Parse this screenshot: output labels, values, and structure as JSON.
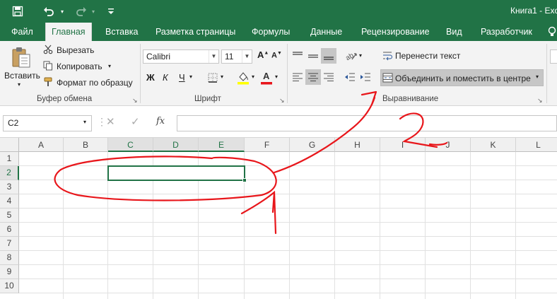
{
  "window": {
    "title": "Книга1 - Exc"
  },
  "tabs": [
    {
      "label": "Файл"
    },
    {
      "label": "Главная"
    },
    {
      "label": "Вставка"
    },
    {
      "label": "Разметка страницы"
    },
    {
      "label": "Формулы"
    },
    {
      "label": "Данные"
    },
    {
      "label": "Рецензирование"
    },
    {
      "label": "Вид"
    },
    {
      "label": "Разработчик"
    }
  ],
  "clipboard": {
    "paste": "Вставить",
    "cut": "Вырезать",
    "copy": "Копировать",
    "format_painter": "Формат по образцу",
    "group": "Буфер обмена"
  },
  "font": {
    "name": "Calibri",
    "size": "11",
    "bold": "Ж",
    "italic": "К",
    "underline": "Ч",
    "group": "Шрифт",
    "font_color_letter": "A"
  },
  "alignment": {
    "wrap": "Перенести текст",
    "merge": "Объединить и поместить в центре",
    "group": "Выравнивание"
  },
  "formula_bar": {
    "name_box": "C2",
    "fx": "fx",
    "value": ""
  },
  "columns": [
    "A",
    "B",
    "C",
    "D",
    "E",
    "F",
    "G",
    "H",
    "I",
    "J",
    "K",
    "L"
  ],
  "rows": [
    "1",
    "2",
    "3",
    "4",
    "5",
    "6",
    "7",
    "8",
    "9",
    "10"
  ],
  "selection": {
    "range": "C2:E2"
  },
  "annotations": {
    "step_label": "2"
  },
  "colors": {
    "accent": "#217346",
    "annotation": "#e8161b",
    "ribbon_bg": "#f3f3f3"
  }
}
